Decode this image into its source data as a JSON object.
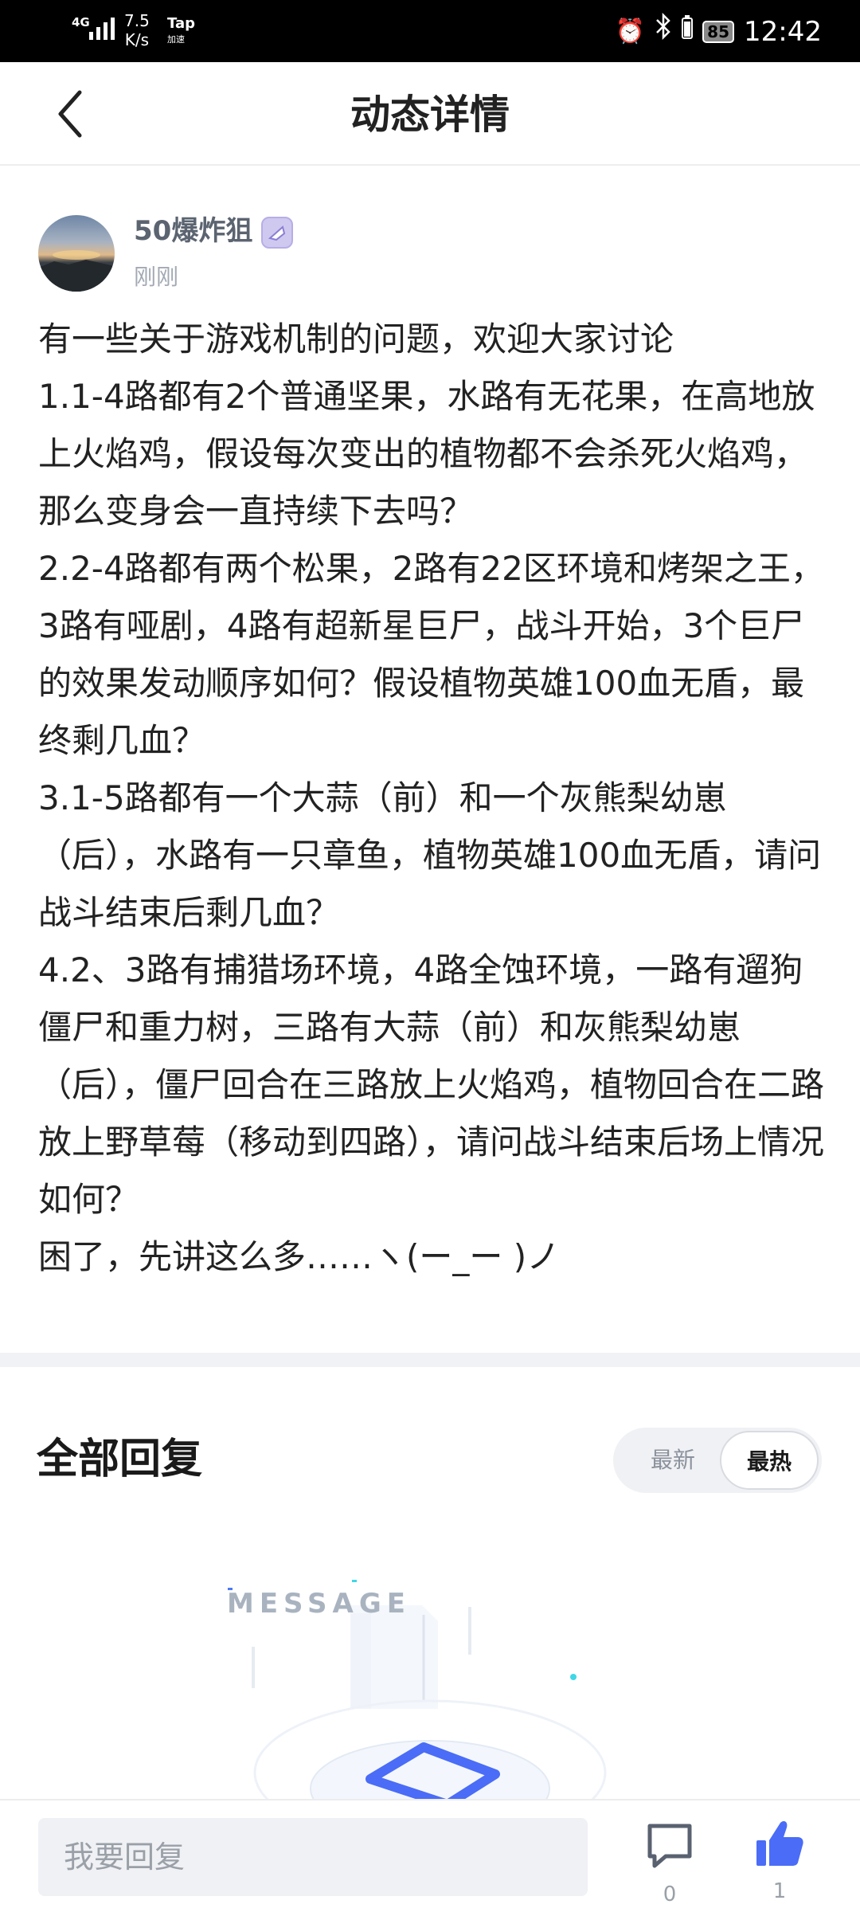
{
  "status_bar": {
    "network": "4G",
    "speed_value": "7.5",
    "speed_unit": "K/s",
    "tap_label": "Tap",
    "tap_sub": "加速",
    "battery": "85",
    "time": "12:42"
  },
  "header": {
    "title": "动态详情"
  },
  "post": {
    "author_name": "50爆炸狙",
    "time": "刚刚",
    "content": "有一些关于游戏机制的问题，欢迎大家讨论\n1.1-4路都有2个普通坚果，水路有无花果，在高地放上火焰鸡，假设每次变出的植物都不会杀死火焰鸡，那么变身会一直持续下去吗？\n2.2-4路都有两个松果，2路有22区环境和烤架之王，3路有哑剧，4路有超新星巨尸，战斗开始，3个巨尸的效果发动顺序如何？假设植物英雄100血无盾，最终剩几血？\n3.1-5路都有一个大蒜（前）和一个灰熊梨幼崽（后），水路有一只章鱼，植物英雄100血无盾，请问战斗结束后剩几血？\n4.2、3路有捕猎场环境，4路全蚀环境，一路有遛狗僵尸和重力树，三路有大蒜（前）和灰熊梨幼崽（后），僵尸回合在三路放上火焰鸡，植物回合在二路放上野草莓（移动到四路），请问战斗结束后场上情况如何？\n困了，先讲这么多……ヽ(ー_ー )ノ"
  },
  "replies": {
    "title": "全部回复",
    "sort_new": "最新",
    "sort_hot": "最热",
    "empty_label": "MESSAGE"
  },
  "bottom_bar": {
    "input_placeholder": "我要回复",
    "comment_count": "0",
    "like_count": "1"
  },
  "colors": {
    "like_blue": "#4a6cf7",
    "text_dark": "#222222",
    "muted": "#a3a9b3"
  },
  "icons": [
    "signal-icon",
    "alarm-icon",
    "bluetooth-icon",
    "battery-icon",
    "back-arrow-icon",
    "author-badge-icon",
    "message-illustration",
    "comment-icon",
    "thumbs-up-icon"
  ]
}
